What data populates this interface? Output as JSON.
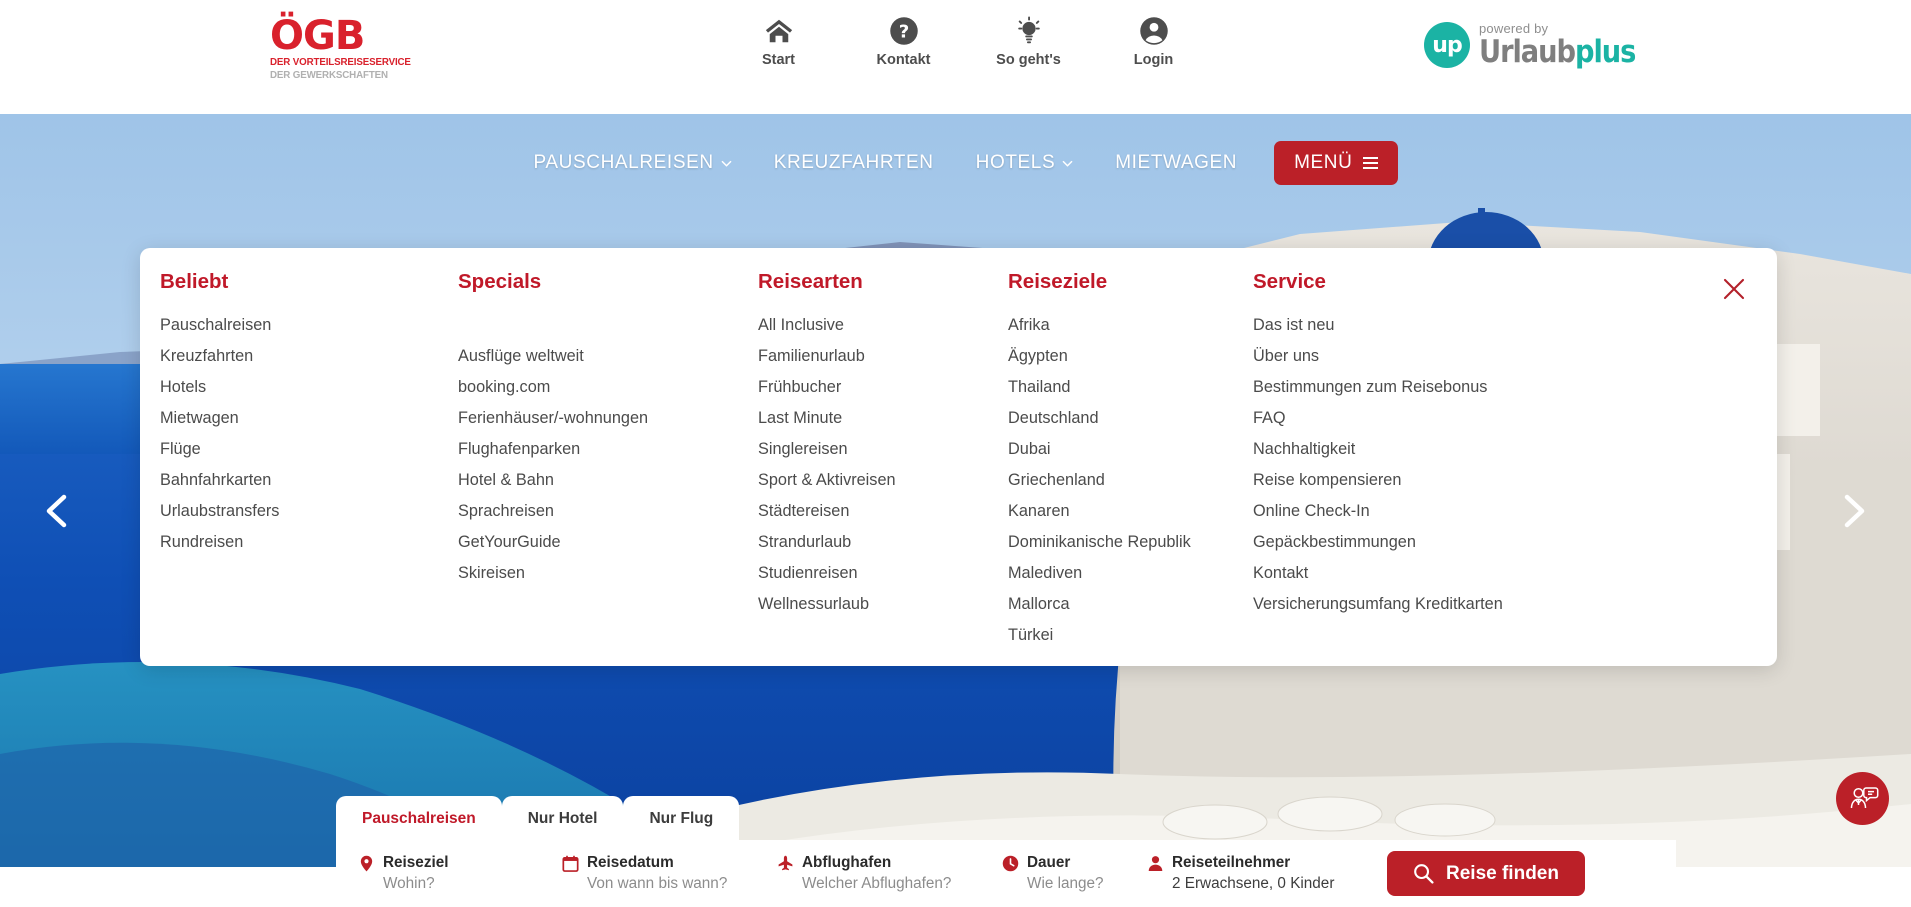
{
  "header": {
    "brand": {
      "name": "ÖGB",
      "tagline_1": "DER VORTEILSREISESERVICE",
      "tagline_2": "DER GEWERKSCHAFTEN",
      "color": "#d9212c"
    },
    "utility_nav": [
      {
        "label": "Start",
        "icon": "home-icon"
      },
      {
        "label": "Kontakt",
        "icon": "question-circle-icon"
      },
      {
        "label": "So geht's",
        "icon": "lightbulb-icon"
      },
      {
        "label": "Login",
        "icon": "user-circle-icon"
      }
    ],
    "partner": {
      "powered_by": "powered by",
      "mark": "up",
      "name_part_1": "Urlaub",
      "name_part_2": "plus",
      "color": "#1bb3a4"
    }
  },
  "hero_nav": {
    "items": [
      {
        "label": "PAUSCHALREISEN",
        "has_caret": true
      },
      {
        "label": "KREUZFAHRTEN",
        "has_caret": false
      },
      {
        "label": "HOTELS",
        "has_caret": true
      },
      {
        "label": "MIETWAGEN",
        "has_caret": false
      }
    ],
    "menu_button": "MENÜ",
    "accent": "#bb2028"
  },
  "megamenu": {
    "accent": "#c01929",
    "close_label": "×",
    "columns": [
      {
        "heading": "Beliebt",
        "offset": false,
        "items": [
          "Pauschalreisen",
          "Kreuzfahrten",
          "Hotels",
          "Mietwagen",
          "Flüge",
          "Bahnfahrkarten",
          "Urlaubstransfers",
          "Rundreisen"
        ]
      },
      {
        "heading": "Specials",
        "offset": true,
        "items": [
          "Ausflüge weltweit",
          "booking.com",
          "Ferienhäuser/-wohnungen",
          "Flughafenparken",
          "Hotel & Bahn",
          "Sprachreisen",
          "GetYourGuide",
          "Skireisen"
        ]
      },
      {
        "heading": "Reisearten",
        "offset": false,
        "items": [
          "All Inclusive",
          "Familienurlaub",
          "Frühbucher",
          "Last Minute",
          "Singlereisen",
          "Sport & Aktivreisen",
          "Städtereisen",
          "Strandurlaub",
          "Studienreisen",
          "Wellnessurlaub"
        ]
      },
      {
        "heading": "Reiseziele",
        "offset": false,
        "items": [
          "Afrika",
          "Ägypten",
          "Thailand",
          "Deutschland",
          "Dubai",
          "Griechenland",
          "Kanaren",
          "Dominikanische Republik",
          "Malediven",
          "Mallorca",
          "Türkei"
        ]
      },
      {
        "heading": "Service",
        "offset": false,
        "items": [
          "Das ist neu",
          "Über uns",
          "Bestimmungen zum Reisebonus",
          "FAQ",
          "Nachhaltigkeit",
          "Reise kompensieren",
          "Online Check-In",
          "Gepäckbestimmungen",
          "Kontakt",
          "Versicherungsumfang Kreditkarten"
        ]
      }
    ]
  },
  "search_widget": {
    "tabs": [
      {
        "label": "Pauschalreisen",
        "active": true
      },
      {
        "label": "Nur Hotel",
        "active": false
      },
      {
        "label": "Nur Flug",
        "active": false
      }
    ],
    "fields": [
      {
        "label": "Reiseziel",
        "value": "Wohin?",
        "filled": false,
        "icon": "map-pin-icon"
      },
      {
        "label": "Reisedatum",
        "value": "Von wann bis wann?",
        "filled": false,
        "icon": "calendar-icon"
      },
      {
        "label": "Abflughafen",
        "value": "Welcher Abflughafen?",
        "filled": false,
        "icon": "plane-icon"
      },
      {
        "label": "Dauer",
        "value": "Wie lange?",
        "filled": false,
        "icon": "clock-icon"
      },
      {
        "label": "Reiseteilnehmer",
        "value": "2 Erwachsene, 0 Kinder",
        "filled": true,
        "icon": "person-icon"
      }
    ],
    "submit_label": "Reise finden",
    "accent": "#bb2028"
  },
  "carousel": {
    "prev_label": "‹",
    "next_label": "›",
    "dots": 3,
    "active_dot": 0
  },
  "support": {
    "icon": "support-chat-icon",
    "color": "#bb2028"
  }
}
